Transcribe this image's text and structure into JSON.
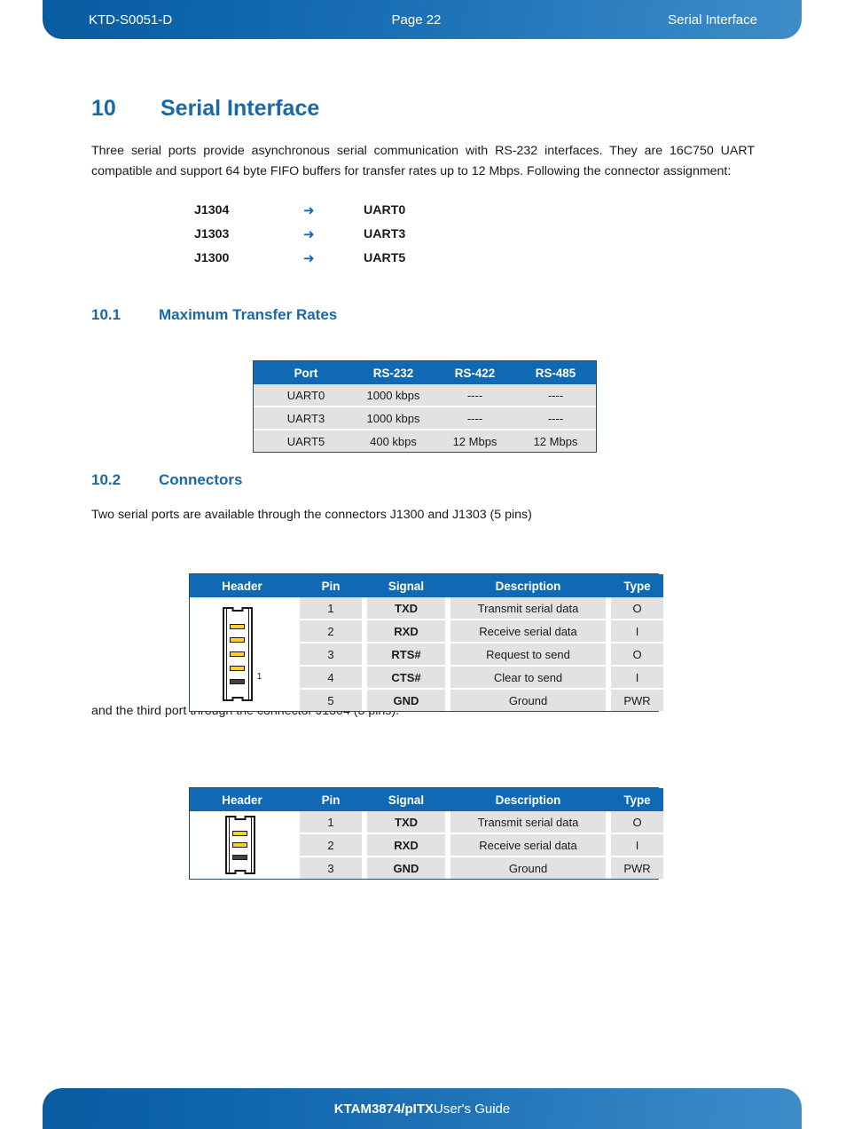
{
  "header": {
    "doc_id": "KTD-S0051-D",
    "page": "Page 22",
    "chapter_name": "Serial Interface"
  },
  "footer": {
    "product": "KTAM3874/pITX",
    "suffix": " User's Guide"
  },
  "chapter": {
    "number": "10",
    "title": "Serial Interface",
    "intro": "Three serial ports provide asynchronous serial communication with RS-232 interfaces. They are 16C750 UART compatible and support 64 byte FIFO buffers for transfer rates up to 12 Mbps. Following the connector assignment:"
  },
  "assignments": [
    {
      "connector": "J1304",
      "arrow": "➜",
      "uart": "UART0"
    },
    {
      "connector": "J1303",
      "arrow": "➜",
      "uart": "UART3"
    },
    {
      "connector": "J1300",
      "arrow": "➜",
      "uart": "UART5"
    }
  ],
  "section_10_1": {
    "number": "10.1",
    "title": "Maximum Transfer Rates",
    "table": {
      "columns": [
        "Port",
        "RS-232",
        "RS-422",
        "RS-485"
      ],
      "rows": [
        [
          "UART0",
          "1000 kbps",
          "----",
          "----"
        ],
        [
          "UART3",
          "1000 kbps",
          "----",
          "----"
        ],
        [
          "UART5",
          "400 kbps",
          "12 Mbps",
          "12 Mbps"
        ]
      ]
    }
  },
  "section_10_2": {
    "number": "10.2",
    "title": "Connectors",
    "intro_5pin": "Two serial ports are available through the connectors J1300 and J1303 (5 pins)",
    "intro_3pin": "and the third port through the connector J1304 (3 pins).",
    "table_5pin": {
      "columns": [
        "Header",
        "Pin",
        "Signal",
        "Description",
        "Type"
      ],
      "connector_label": "1",
      "pins": [
        {
          "pin": "1",
          "signal": "TXD",
          "description": "Transmit serial data",
          "type": "O"
        },
        {
          "pin": "2",
          "signal": "RXD",
          "description": "Receive serial data",
          "type": "I"
        },
        {
          "pin": "3",
          "signal": "RTS#",
          "description": "Request to send",
          "type": "O"
        },
        {
          "pin": "4",
          "signal": "CTS#",
          "description": "Clear to send",
          "type": "I"
        },
        {
          "pin": "5",
          "signal": "GND",
          "description": "Ground",
          "type": "PWR"
        }
      ]
    },
    "table_3pin": {
      "columns": [
        "Header",
        "Pin",
        "Signal",
        "Description",
        "Type"
      ],
      "connector_label": "",
      "pins": [
        {
          "pin": "1",
          "signal": "TXD",
          "description": "Transmit serial data",
          "type": "O"
        },
        {
          "pin": "2",
          "signal": "RXD",
          "description": "Receive serial data",
          "type": "I"
        },
        {
          "pin": "3",
          "signal": "GND",
          "description": "Ground",
          "type": "PWR"
        }
      ]
    }
  },
  "colors": {
    "brand_blue": "#1069b4",
    "heading_blue": "#1a68a8",
    "table_row": "#e2e2e2",
    "pin_signal": "#ffd02a",
    "pin_ground": "#474239"
  }
}
